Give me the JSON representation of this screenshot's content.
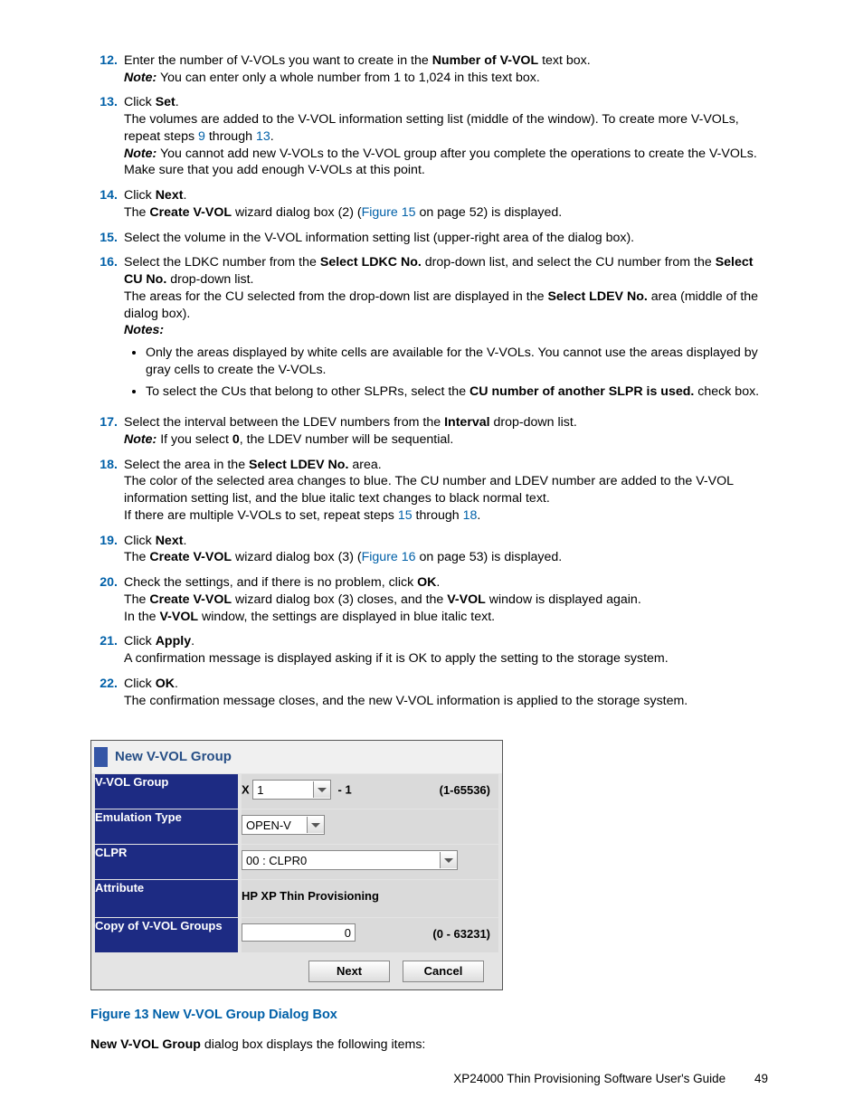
{
  "steps": [
    {
      "n": "12.",
      "html": "Enter the number of V-VOLs you want to create in the <b>Number of V-VOL</b> text box.<br><span class='noteslabel'>Note:</span>  You can enter only a whole number from 1 to 1,024 in this text box."
    },
    {
      "n": "13.",
      "html": "Click <b>Set</b>.<br>The volumes are added to the V-VOL information setting list (middle of the window).  To create more V-VOLs, repeat steps <span class='link'>9</span> through <span class='link'>13</span>.<br><span class='noteslabel'>Note:</span> You cannot add new V-VOLs to the V-VOL group after you complete the operations to create the V-VOLs.  Make sure that you add enough V-VOLs at this point."
    },
    {
      "n": "14.",
      "html": "Click <b>Next</b>.<br>The <b>Create V-VOL</b> wizard dialog box (2) (<span class='link'>Figure 15</span> on page 52) is displayed."
    },
    {
      "n": "15.",
      "html": "Select the volume in the V-VOL information setting list (upper-right area of the dialog box)."
    },
    {
      "n": "16.",
      "html": "Select the LDKC number from the <b>Select LDKC No.</b> drop-down list, and select the CU number from the <b>Select CU No.</b>  drop-down list.<br>The areas for the CU selected from the drop-down list are displayed in the <b>Select LDEV No.</b> area (middle of the dialog box).<br><span class='noteslabel'>Notes:</span>",
      "bullets": [
        "Only the areas displayed by white cells are available for the V-VOLs.  You cannot use the areas displayed by gray cells to create the V-VOLs.",
        "To select the CUs that belong to other SLPRs, select the <b>CU number of another SLPR is used.</b> check box."
      ]
    },
    {
      "n": "17.",
      "html": "Select the interval between the LDEV numbers from the <b>Interval</b> drop-down list.<br><span class='noteslabel'>Note:</span> If you select <b>0</b>, the LDEV number will be sequential."
    },
    {
      "n": "18.",
      "html": "Select the area in the <b>Select LDEV No.</b>  area.<br>The color of the selected area changes to blue.  The CU number and LDEV number are added to the V-VOL information setting list, and the blue italic text changes to black normal text.<br>If there are multiple V-VOLs to set, repeat steps <span class='link'>15</span> through <span class='link'>18</span>."
    },
    {
      "n": "19.",
      "html": "Click <b>Next</b>.<br>The <b>Create V-VOL</b> wizard dialog box (3) (<span class='link'>Figure 16</span> on page 53) is displayed."
    },
    {
      "n": "20.",
      "html": "Check the settings, and if there is no problem, click <b>OK</b>.<br>The <b>Create V-VOL</b> wizard dialog box (3) closes, and the <b>V-VOL</b> window is displayed again.<br>In the <b>V-VOL</b> window, the settings are displayed in blue italic text."
    },
    {
      "n": "21.",
      "html": "Click <b>Apply</b>.<br>A confirmation message is displayed asking if it is OK to apply the setting to the storage system."
    },
    {
      "n": "22.",
      "html": "Click <b>OK</b>.<br>The confirmation message closes, and the new V-VOL information is applied to the storage system."
    }
  ],
  "dialog": {
    "title": "New V-VOL Group",
    "rows": {
      "vvol_label": "V-VOL Group",
      "vvol_prefix": "X",
      "vvol_value": "1",
      "vvol_suffix": "- 1",
      "vvol_hint": "(1-65536)",
      "emu_label": "Emulation Type",
      "emu_value": "OPEN-V",
      "clpr_label": "CLPR",
      "clpr_value": "00 : CLPR0",
      "attr_label": "Attribute",
      "attr_value": "HP XP Thin Provisioning",
      "copy_label": "Copy of V-VOL Groups",
      "copy_value": "0",
      "copy_hint": "(0 - 63231)"
    },
    "buttons": {
      "next": "Next",
      "cancel": "Cancel"
    }
  },
  "figcaption": "Figure 13 New V-VOL Group Dialog Box",
  "after": "<b>New V-VOL Group</b> dialog box displays the following items:",
  "footer_title": "XP24000 Thin Provisioning Software User's Guide",
  "footer_page": "49"
}
